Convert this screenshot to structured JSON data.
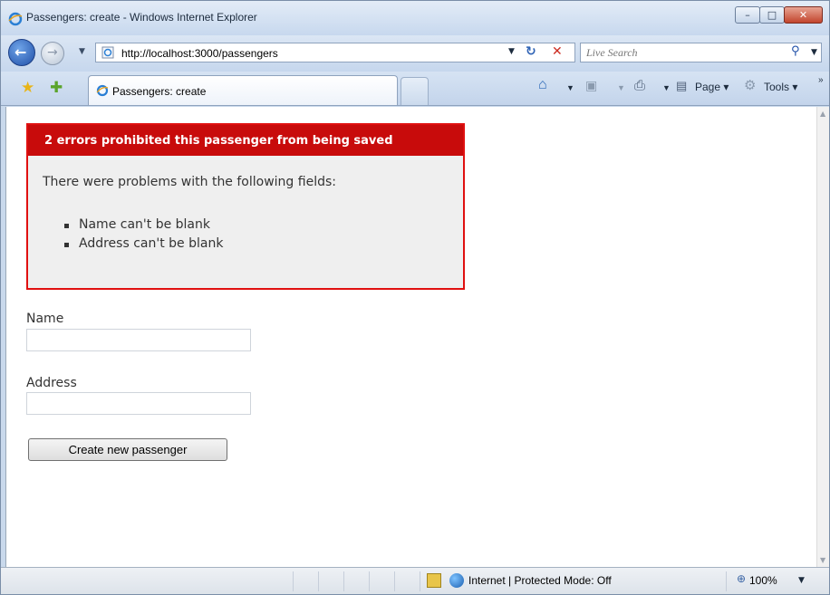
{
  "window": {
    "title": "Passengers: create - Windows Internet Explorer",
    "controls": {
      "minimize": "–",
      "maximize": "□",
      "close": "✕"
    }
  },
  "navbar": {
    "url": "http://localhost:3000/passengers",
    "search_placeholder": "Live Search",
    "back_glyph": "←",
    "forward_glyph": "→",
    "refresh_glyph": "↻",
    "stop_glyph": "✕",
    "search_glyph": "⚲",
    "dropdown_glyph": "▼"
  },
  "tabs": {
    "active_label": "Passengers: create"
  },
  "toolbar": {
    "page_label": "Page ▾",
    "tools_label": "Tools ▾",
    "home_glyph": "⌂",
    "feeds_glyph": "▣",
    "print_glyph": "⎙",
    "page_glyph": "▤",
    "tools_glyph": "⚙",
    "chevron_glyph": "»",
    "favorites_glyph": "★",
    "add_favorites_glyph": "✚"
  },
  "error_box": {
    "title": "2 errors prohibited this passenger from being saved",
    "intro": "There were problems with the following fields:",
    "items": [
      "Name can't be blank",
      "Address can't be blank"
    ]
  },
  "form": {
    "name_label": "Name",
    "name_value": "",
    "address_label": "Address",
    "address_value": "",
    "submit_label": "Create new passenger"
  },
  "statusbar": {
    "zone": "Internet | Protected Mode: Off",
    "zoom": "100%",
    "zoom_glyph": "⊕"
  },
  "colors": {
    "error_border": "#e01010",
    "error_header": "#c80b0b",
    "error_bg": "#efefef",
    "chrome_blue": "#c9d9ec"
  }
}
